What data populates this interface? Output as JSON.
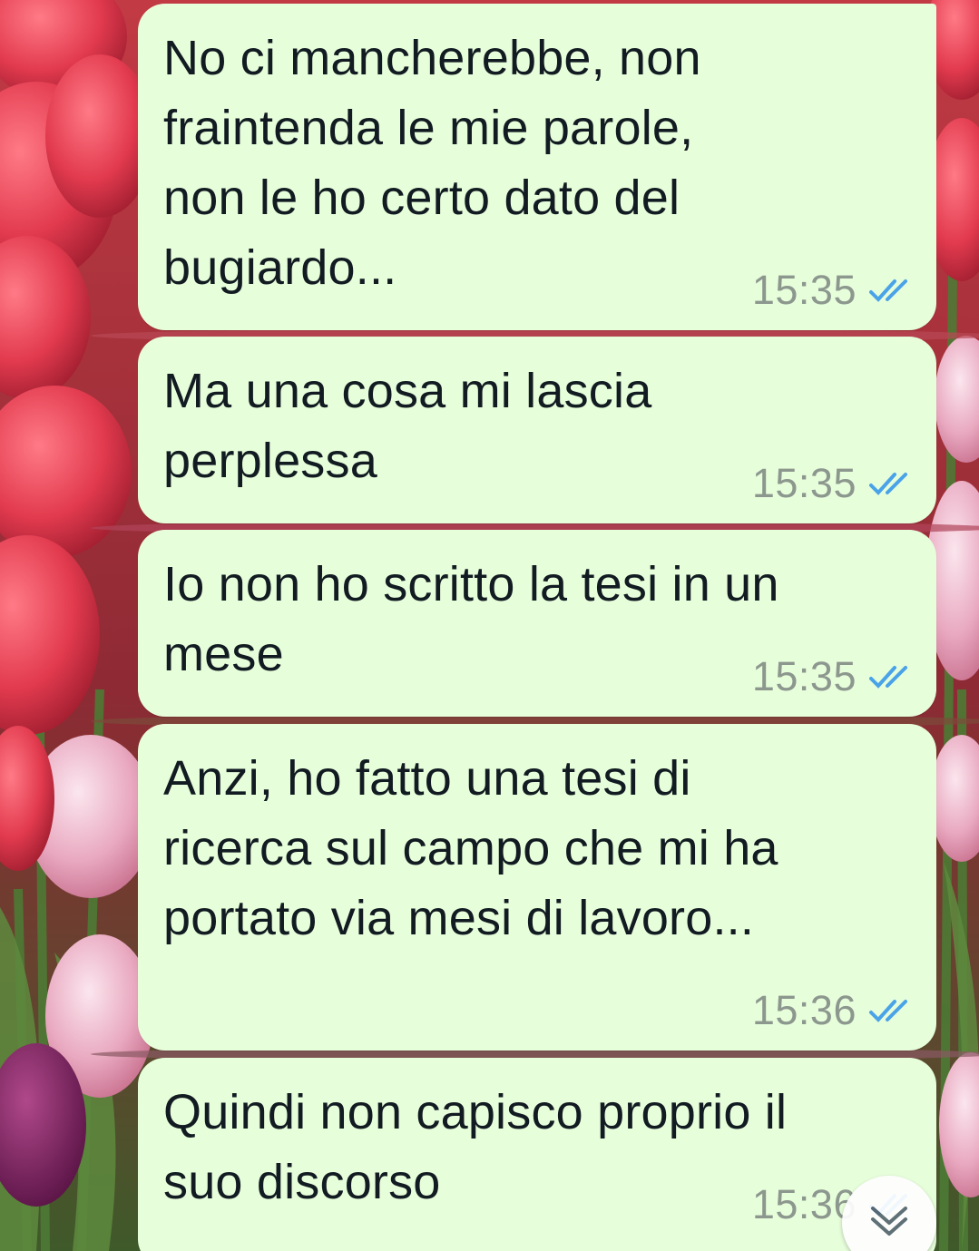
{
  "wallpaper": {
    "description_icon": "tulip-field-icon"
  },
  "colors": {
    "bubble_bg": "#e7fedb",
    "text": "#111b21",
    "time": "#8c978e",
    "read_tick": "#4aa3e8"
  },
  "messages": [
    {
      "text": "No ci mancherebbe, non\nfraintenda le mie parole,\nnon le ho certo dato del\nbugiardo...",
      "time": "15:35",
      "status_icon": "double-check-read-icon"
    },
    {
      "text": "Ma una cosa mi lascia\nperplessa",
      "time": "15:35",
      "status_icon": "double-check-read-icon"
    },
    {
      "text": "Io non ho scritto la tesi in un\nmese",
      "time": "15:35",
      "status_icon": "double-check-read-icon"
    },
    {
      "text": "Anzi, ho fatto una tesi di\nricerca sul campo che mi ha\nportato via mesi di lavoro...",
      "time": "15:36",
      "status_icon": "double-check-read-icon"
    },
    {
      "text": "Quindi non capisco proprio il\nsuo discorso",
      "time": "15:36",
      "status_icon": "double-check-read-icon"
    }
  ],
  "scroll_button": {
    "icon": "chevron-double-down-icon"
  }
}
